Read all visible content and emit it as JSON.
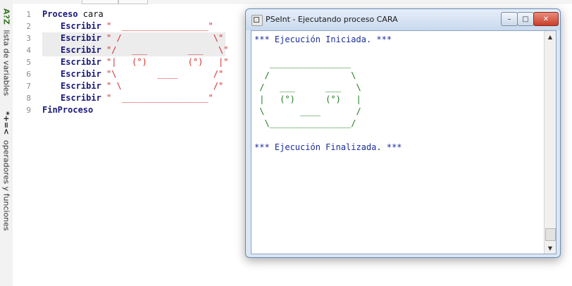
{
  "side_panel": {
    "variables_icon": "A?Z",
    "variables_label": "lista de variables",
    "operators_icon": "*+=<",
    "operators_label": "operadores y funciones"
  },
  "editor": {
    "line_numbers": [
      "1",
      "2",
      "3",
      "4",
      "5",
      "6",
      "7",
      "8",
      "9"
    ],
    "lines": [
      {
        "kw": "Proceso",
        "rest": " cara"
      },
      {
        "kw": "Escribir",
        "str": " \"  _________________\""
      },
      {
        "kw": "Escribir",
        "str": " \" /                  \\\""
      },
      {
        "kw": "Escribir",
        "str": " \"/   ___        ___   \\\""
      },
      {
        "kw": "Escribir",
        "str": " \"|   (°)        (°)   |\""
      },
      {
        "kw": "Escribir",
        "str": " \"\\        ____       /\""
      },
      {
        "kw": "Escribir",
        "str": " \" \\                  /\""
      },
      {
        "kw": "Escribir",
        "str": " \"  _________________\""
      },
      {
        "kw": "FinProceso",
        "rest": ""
      }
    ]
  },
  "window": {
    "title": "PSeInt - Ejecutando proceso CARA",
    "minimize_label": "–",
    "maximize_label": "□",
    "close_label": "✕"
  },
  "console": {
    "start_msg": "*** Ejecución Iniciada. ***",
    "art": [
      "   ________________",
      "  /                \\",
      " /   ___      ___   \\",
      " |   (°)      (°)   |",
      " \\       ____       /",
      "  \\________________/"
    ],
    "end_msg": "*** Ejecución Finalizada. ***"
  },
  "colors": {
    "keyword": "#1a1a7a",
    "string": "#d42a2a",
    "console_message": "#1a2c9a",
    "console_art": "#1e7a1e"
  }
}
